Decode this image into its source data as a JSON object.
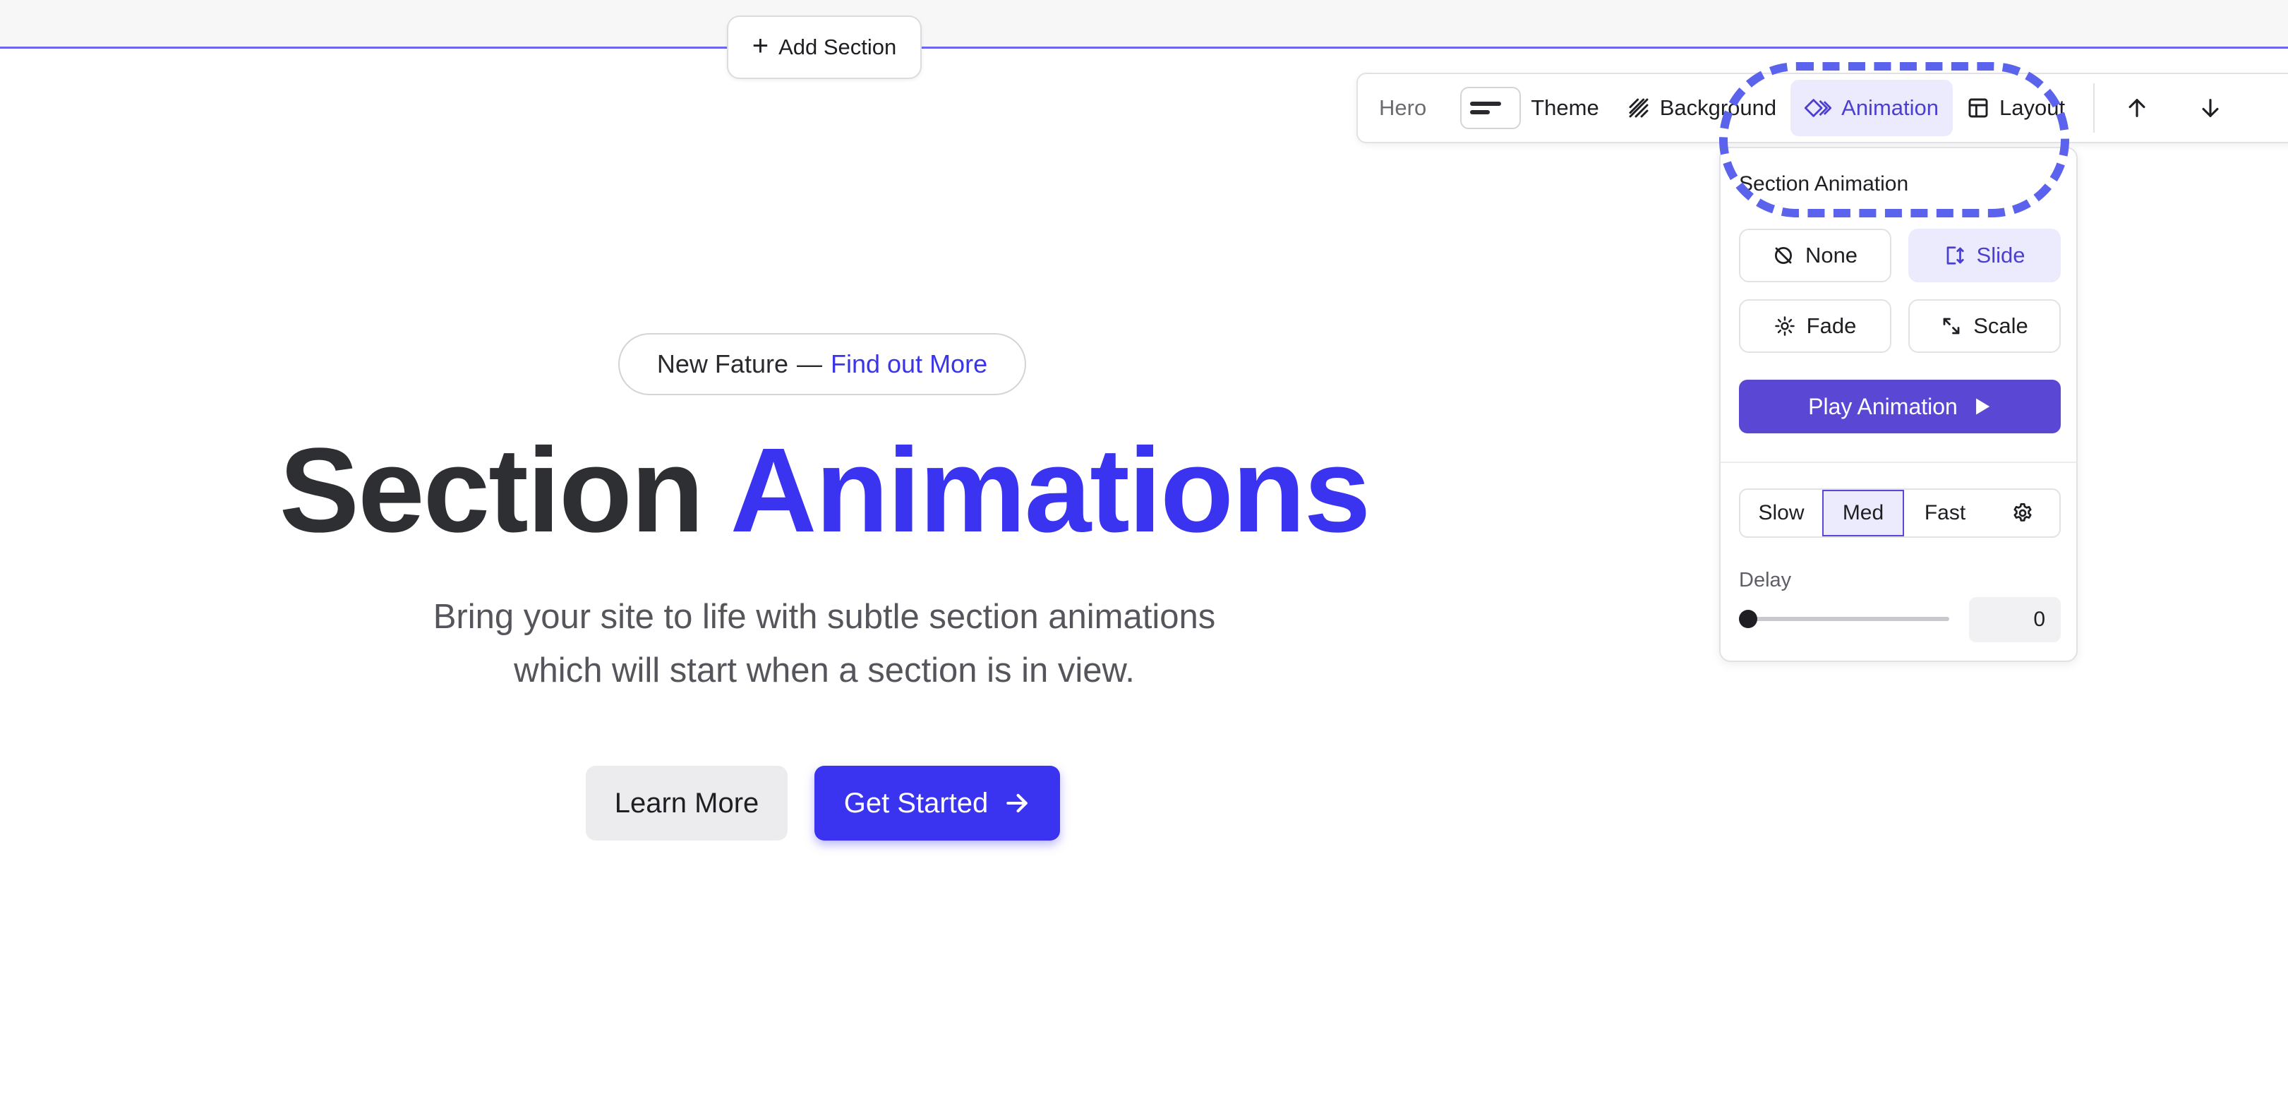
{
  "editor": {
    "add_section_label": "Add Section"
  },
  "toolbar": {
    "section_label": "Hero",
    "theme_label": "Theme",
    "background_label": "Background",
    "animation_label": "Animation",
    "layout_label": "Layout",
    "active_item": "Animation"
  },
  "panel": {
    "title": "Section Animation",
    "options": [
      {
        "label": "None",
        "icon": "circle-slash-icon"
      },
      {
        "label": "Slide",
        "icon": "slide-icon"
      },
      {
        "label": "Fade",
        "icon": "sun-icon"
      },
      {
        "label": "Scale",
        "icon": "expand-arrows-icon"
      }
    ],
    "selected_option": "Slide",
    "play_label": "Play Animation",
    "speeds": [
      "Slow",
      "Med",
      "Fast"
    ],
    "selected_speed": "Med",
    "delay_label": "Delay",
    "delay_value": "0",
    "delay_slider_fraction": 0
  },
  "hero": {
    "badge_text": "New Fature",
    "badge_dash": "—",
    "badge_link": "Find out More",
    "title_part1": "Section",
    "title_part2": "Animations",
    "subtitle_line1": "Bring your site to life with subtle section animations",
    "subtitle_line2": "which will start when a section is in view.",
    "learn_more_label": "Learn More",
    "get_started_label": "Get Started"
  },
  "colors": {
    "accent": "#3a33ef",
    "panel_accent": "#5a48d4",
    "active_bg": "#ecebfd",
    "highlight_dash": "#5b62ec"
  }
}
